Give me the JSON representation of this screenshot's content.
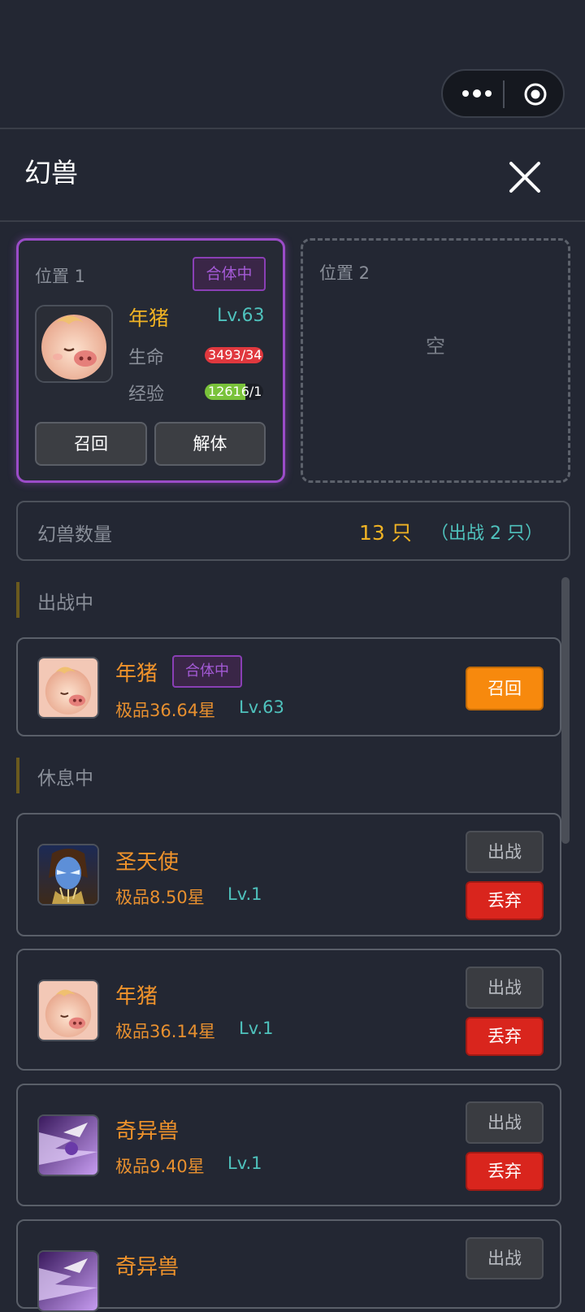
{
  "header": {
    "title": "幻兽"
  },
  "slots": [
    {
      "label": "位置 1",
      "badge": "合体中",
      "name": "年猪",
      "level": "Lv.63",
      "hp_label": "生命",
      "hp_text": "3493/34",
      "hp_fraction": 1.0,
      "exp_label": "经验",
      "exp_text": "12616/1",
      "exp_fraction": 0.7,
      "recall_label": "召回",
      "unmerge_label": "解体"
    },
    {
      "label": "位置 2",
      "empty_text": "空"
    }
  ],
  "count": {
    "label": "幻兽数量",
    "value": "13 只",
    "battle": "（出战 2 只）"
  },
  "sections": {
    "active": "出战中",
    "resting": "休息中"
  },
  "active_pets": [
    {
      "name": "年猪",
      "badge": "合体中",
      "quality": "极品36.64星",
      "level": "Lv.63",
      "recall_label": "召回"
    }
  ],
  "resting_pets": [
    {
      "name": "圣天使",
      "quality": "极品8.50星",
      "level": "Lv.1",
      "fight_label": "出战",
      "discard_label": "丢弃",
      "icon": "angel-icon"
    },
    {
      "name": "年猪",
      "quality": "极品36.14星",
      "level": "Lv.1",
      "fight_label": "出战",
      "discard_label": "丢弃",
      "icon": "pig-icon"
    },
    {
      "name": "奇异兽",
      "quality": "极品9.40星",
      "level": "Lv.1",
      "fight_label": "出战",
      "discard_label": "丢弃",
      "icon": "beast-icon"
    },
    {
      "name": "奇异兽",
      "fight_label": "出战",
      "icon": "beast-icon"
    }
  ],
  "colors": {
    "background": "#232733",
    "accent_purple": "#9b4cc8",
    "gold": "#f0b324",
    "teal": "#4fc2bd",
    "orange": "#f7890d",
    "red": "#d9251d"
  }
}
